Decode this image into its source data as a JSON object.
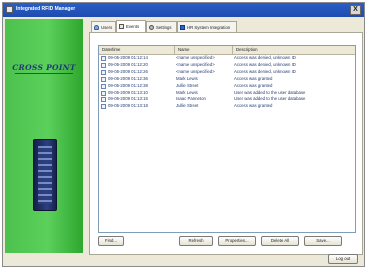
{
  "window": {
    "title": "Integrated RFID Manager",
    "close_label": "X"
  },
  "brand": {
    "logo_text": "CROSS POINT"
  },
  "tabs": [
    {
      "label": "Users",
      "icon": "user-icon"
    },
    {
      "label": "Events",
      "icon": "events-icon"
    },
    {
      "label": "Settings",
      "icon": "gear-icon"
    },
    {
      "label": "HR System Integration",
      "icon": "hr-icon"
    }
  ],
  "events_table": {
    "columns": [
      "Date/time",
      "Name",
      "Description"
    ],
    "rows": [
      [
        "09-05-2009 01:12:14",
        "<name unspecified>",
        "Access was denied, unknown ID"
      ],
      [
        "09-05-2009 01:12:20",
        "<name unspecified>",
        "Access was denied, unknown ID"
      ],
      [
        "09-05-2009 01:12:26",
        "<name unspecified>",
        "Access was denied, unknown ID"
      ],
      [
        "09-05-2009 01:12:36",
        "Mark Lewis",
        "Access was granted"
      ],
      [
        "09-05-2009 01:12:38",
        "Jullie Street",
        "Access was granted"
      ],
      [
        "09-05-2009 01:13:10",
        "Mark Lewis",
        "User was added to the user database"
      ],
      [
        "09-05-2009 01:13:15",
        "Isaac Panneton",
        "User was added to the user database"
      ],
      [
        "09-05-2009 01:13:18",
        "Jullie Street",
        "Access was granted"
      ]
    ]
  },
  "buttons": {
    "find": "Find...",
    "refresh": "Refresh",
    "properties": "Properties...",
    "delete_all": "Delete All",
    "save": "Save...",
    "logout": "Log out"
  }
}
